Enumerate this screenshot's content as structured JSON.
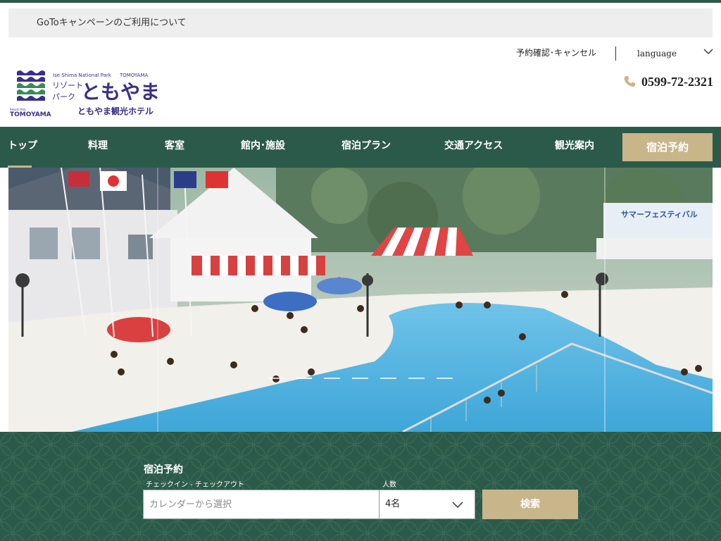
{
  "notice_bar": {
    "text": "GoToキャンペーンのご利用について"
  },
  "utility": {
    "reservation_link": "予約確認･キャンセル",
    "language_label": "language"
  },
  "logo": {
    "park_en": "Ise Shima National Park",
    "brand_en": "TOMOYAMA",
    "resort_line1": "リゾート",
    "resort_line2": "パーク",
    "name_jp": "ともやま",
    "hotel_name": "ともやま観光ホテル",
    "sub_small": "Resort Park",
    "sub_en": "TOMOYAMA"
  },
  "contact": {
    "phone": "0599-72-2321",
    "icon": "phone-icon"
  },
  "nav": {
    "items": [
      {
        "label": "トップ",
        "active": true
      },
      {
        "label": "料理"
      },
      {
        "label": "客室"
      },
      {
        "label": "館内･施設"
      },
      {
        "label": "宿泊プラン"
      },
      {
        "label": "交通アクセス"
      },
      {
        "label": "観光案内"
      }
    ],
    "cta": "宿泊予約"
  },
  "hero": {
    "banner_text": "サマーフェスティバル",
    "slide_count": 7,
    "active_slide": 2
  },
  "booking": {
    "title": "宿泊予約",
    "date_label": "チェックイン - チェックアウト",
    "date_placeholder": "カレンダーから選択",
    "guests_label": "人数",
    "guests_value": "4名",
    "search_label": "検索"
  },
  "colors": {
    "primary_green": "#2c5a4a",
    "accent_gold": "#c8b58a",
    "logo_purple": "#3a2f8a",
    "logo_green": "#3a8a5a"
  }
}
